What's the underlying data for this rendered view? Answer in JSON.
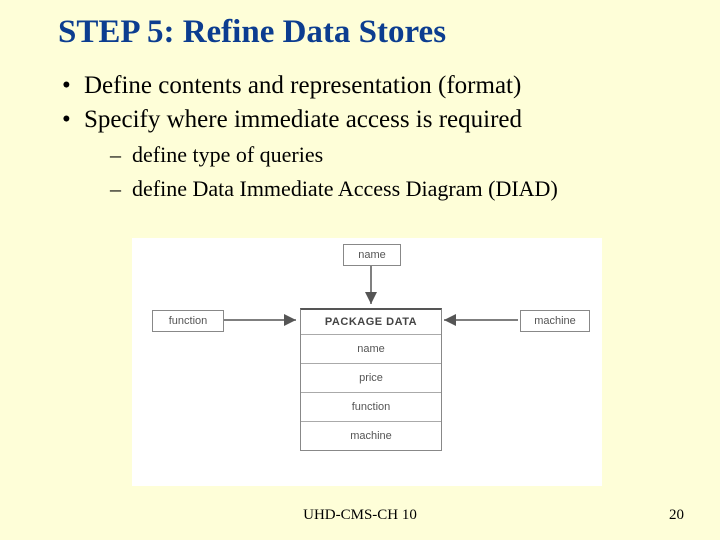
{
  "title": "STEP 5: Refine Data Stores",
  "bullets": [
    "Define contents and representation (format)",
    "Specify where immediate access is required"
  ],
  "sub_bullets": [
    "define type of queries",
    "define Data Immediate Access Diagram (DIAD)"
  ],
  "diagram": {
    "top_box": "name",
    "left_box": "function",
    "right_box": "machine",
    "stack_header": "PACKAGE DATA",
    "stack_rows": [
      "name",
      "price",
      "function",
      "machine"
    ]
  },
  "footer": {
    "center": "UHD-CMS-CH 10",
    "right": "20"
  }
}
